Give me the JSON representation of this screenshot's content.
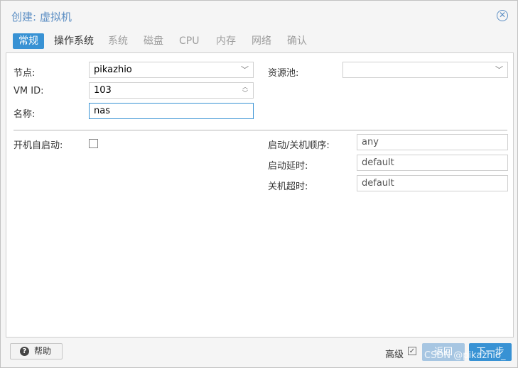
{
  "window": {
    "title": "创建: 虚拟机"
  },
  "tabs": [
    {
      "label": "常规",
      "state": "active"
    },
    {
      "label": "操作系统",
      "state": "enabled"
    },
    {
      "label": "系统",
      "state": "disabled"
    },
    {
      "label": "磁盘",
      "state": "disabled"
    },
    {
      "label": "CPU",
      "state": "disabled"
    },
    {
      "label": "内存",
      "state": "disabled"
    },
    {
      "label": "网络",
      "state": "disabled"
    },
    {
      "label": "确认",
      "state": "disabled"
    }
  ],
  "form": {
    "node_label": "节点:",
    "node_value": "pikazhio",
    "vmid_label": "VM ID:",
    "vmid_value": "103",
    "name_label": "名称:",
    "name_value": "nas",
    "pool_label": "资源池:",
    "pool_value": "",
    "autostart_label": "开机自启动:",
    "autostart_checked": false,
    "order_label": "启动/关机顺序:",
    "order_value": "any",
    "delay_label": "启动延时:",
    "delay_value": "default",
    "timeout_label": "关机超时:",
    "timeout_value": "default"
  },
  "footer": {
    "help_label": "帮助",
    "advanced_label": "高级",
    "advanced_checked": true,
    "back_label": "返回",
    "next_label": "下一步",
    "watermark": "CSDN @pikazhio_"
  },
  "colors": {
    "accent": "#3892d4",
    "title": "#5d8fc4",
    "disabled_button": "#a7c6e2"
  }
}
